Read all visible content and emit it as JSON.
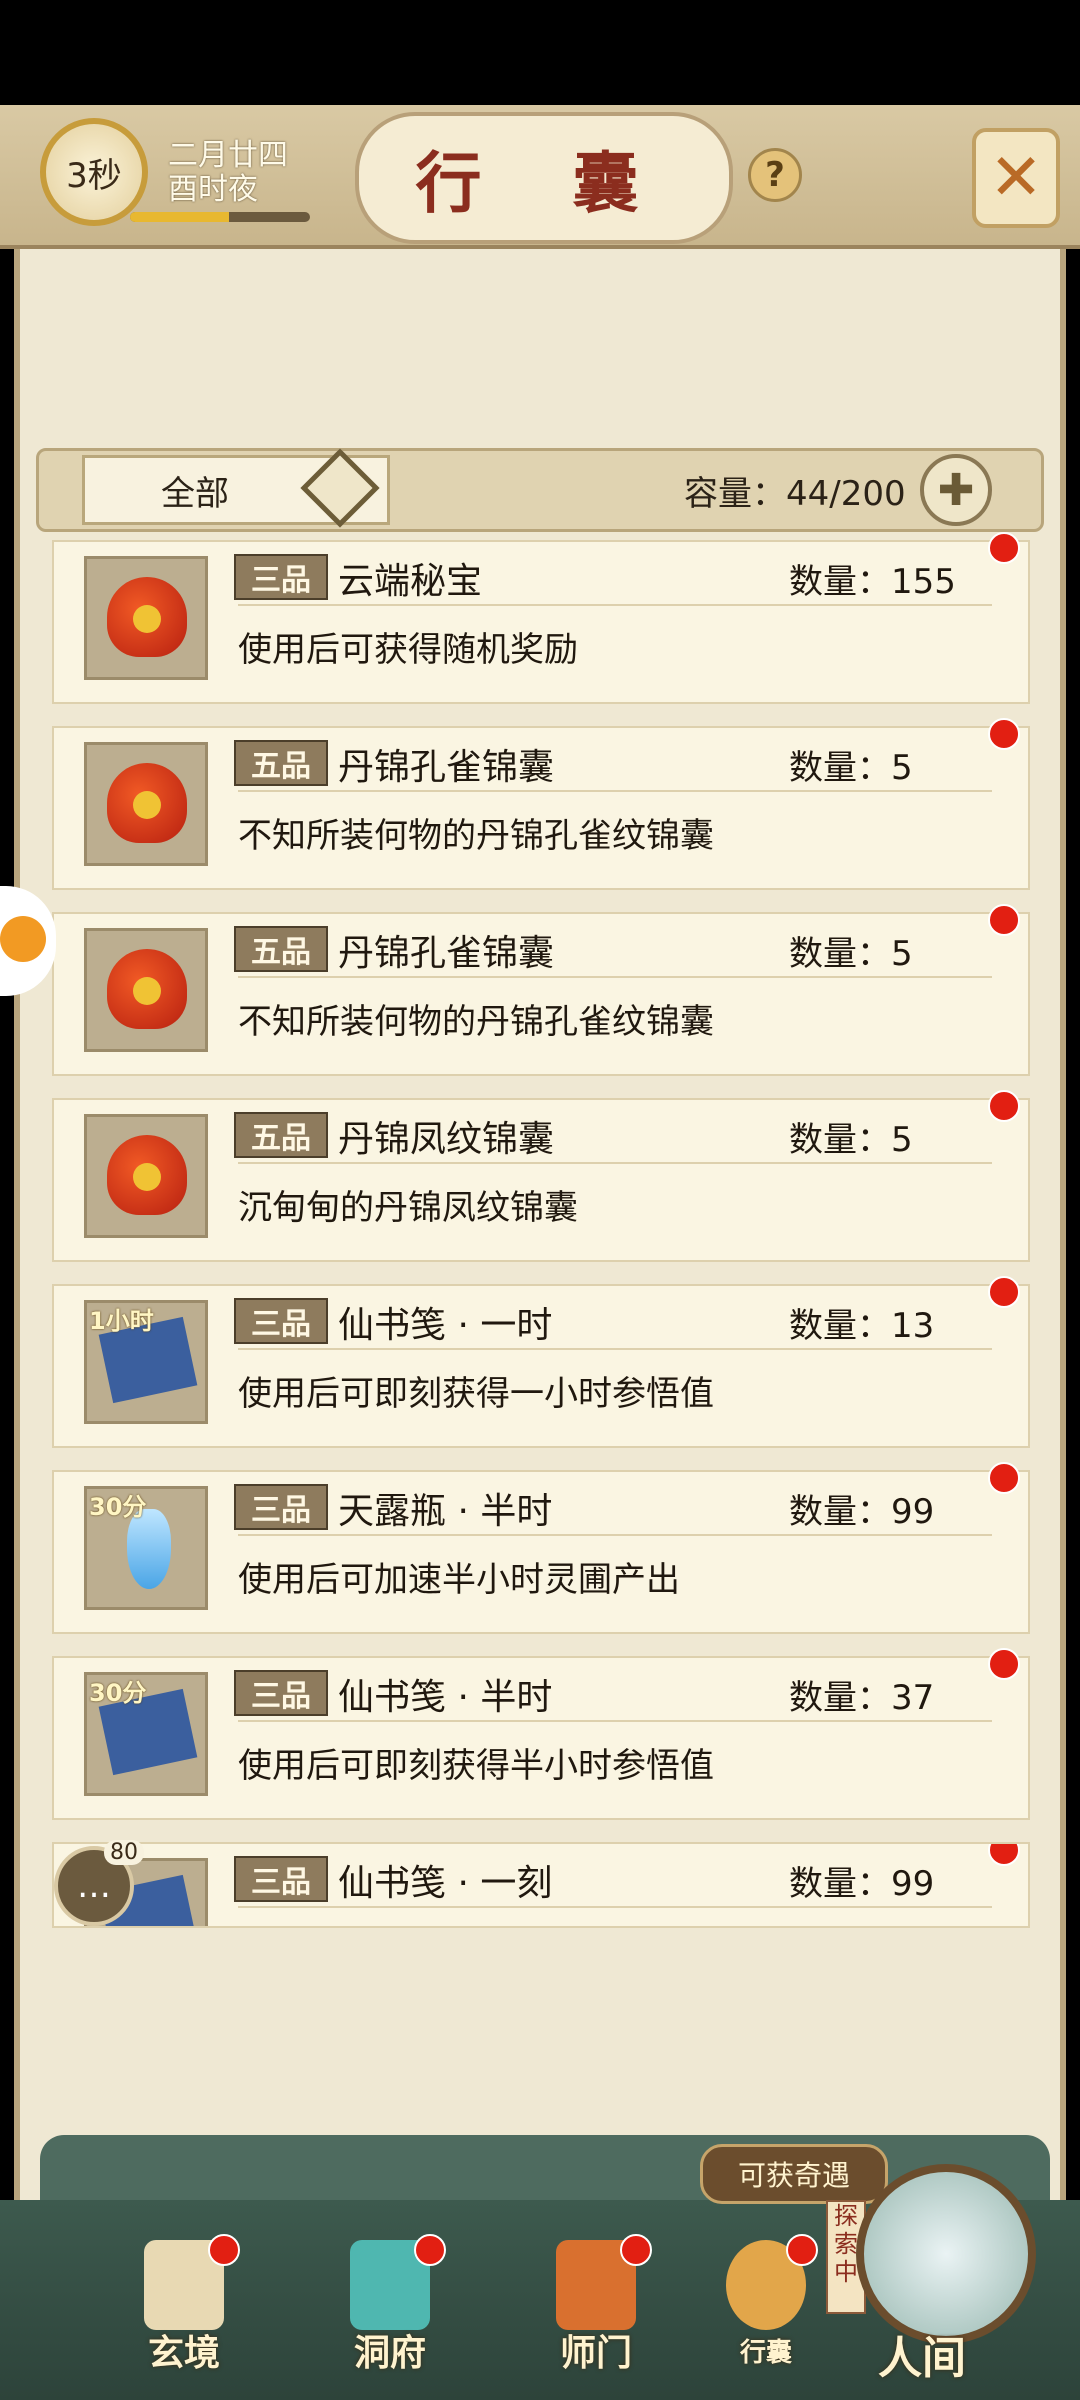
{
  "header": {
    "timer": "3秒",
    "date_line1": "二月廿四",
    "date_line2": "酉时夜",
    "day_progress": 0.55,
    "title": "行 囊",
    "help_icon": "?",
    "close_icon": "close-icon"
  },
  "filter": {
    "selected": "全部",
    "capacity": "容量：44/200"
  },
  "items": [
    {
      "rank": "三品",
      "name": "云端秘宝",
      "qty": "数量：155",
      "desc": "使用后可获得随机奖励",
      "icon": "bag-icon",
      "tag": ""
    },
    {
      "rank": "五品",
      "name": "丹锦孔雀锦囊",
      "qty": "数量：5",
      "desc": "不知所装何物的丹锦孔雀纹锦囊",
      "icon": "bag-icon",
      "tag": ""
    },
    {
      "rank": "五品",
      "name": "丹锦孔雀锦囊",
      "qty": "数量：5",
      "desc": "不知所装何物的丹锦孔雀纹锦囊",
      "icon": "bag-icon",
      "tag": ""
    },
    {
      "rank": "五品",
      "name": "丹锦凤纹锦囊",
      "qty": "数量：5",
      "desc": "沉甸甸的丹锦凤纹锦囊",
      "icon": "bag-icon",
      "tag": ""
    },
    {
      "rank": "三品",
      "name": "仙书笺 · 一时",
      "qty": "数量：13",
      "desc": "使用后可即刻获得一小时参悟值",
      "icon": "book-icon",
      "tag": "1小时"
    },
    {
      "rank": "三品",
      "name": "天露瓶 · 半时",
      "qty": "数量：99",
      "desc": "使用后可加速半小时灵圃产出",
      "icon": "bottle-icon",
      "tag": "30分"
    },
    {
      "rank": "三品",
      "name": "仙书笺 · 半时",
      "qty": "数量：37",
      "desc": "使用后可即刻获得半小时参悟值",
      "icon": "book-icon",
      "tag": "30分"
    },
    {
      "rank": "三品",
      "name": "仙书笺 · 一刻",
      "qty": "数量：99",
      "desc": "",
      "icon": "book-icon",
      "tag": "分"
    }
  ],
  "chat_count": "80",
  "nav": {
    "qiyu": "可获奇遇",
    "explore": "探索中",
    "tabs": [
      "玄境",
      "洞府",
      "师门",
      "行囊",
      "人间"
    ]
  },
  "colors": {
    "accent": "#8b2d1e",
    "badge": "#e21f12",
    "panel": "#efe8d3"
  }
}
